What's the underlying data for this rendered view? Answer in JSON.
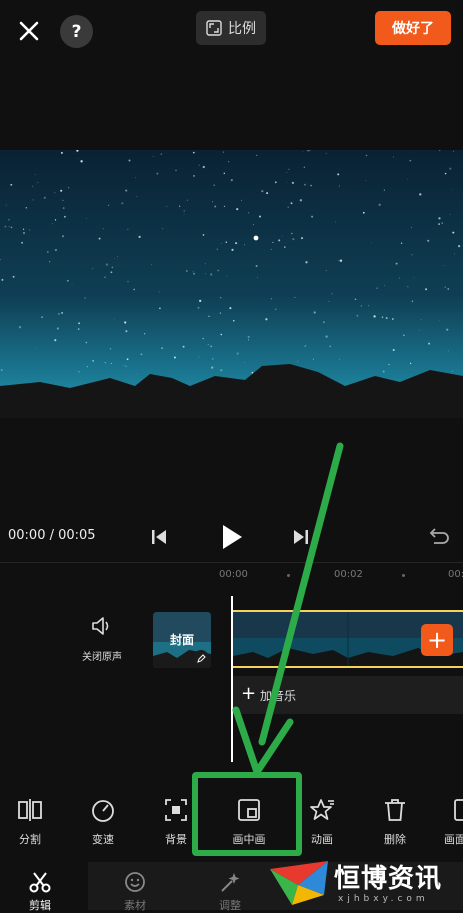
{
  "topbar": {
    "ratio_label": "比例",
    "done_label": "做好了",
    "help_label": "?"
  },
  "player": {
    "timecode": "00:00 / 00:05"
  },
  "ruler": {
    "ticks": [
      "00:00",
      "00:02",
      "00:0"
    ]
  },
  "timeline": {
    "mute_label": "关闭原声",
    "cover_label": "封面",
    "add_music_label": "加音乐",
    "add_music_plus": "+"
  },
  "tools": [
    {
      "label": "分割",
      "icon": "split-icon"
    },
    {
      "label": "变速",
      "icon": "speed-icon"
    },
    {
      "label": "背景",
      "icon": "background-icon"
    },
    {
      "label": "画中画",
      "icon": "picture-in-picture-icon"
    },
    {
      "label": "动画",
      "icon": "animation-icon"
    },
    {
      "label": "删除",
      "icon": "trash-icon"
    },
    {
      "label": "画面",
      "icon": "frame-icon"
    }
  ],
  "nav": [
    {
      "label": "剪辑",
      "icon": "scissors-icon"
    },
    {
      "label": "素材",
      "icon": "sticker-icon"
    },
    {
      "label": "调整",
      "icon": "adjust-icon"
    }
  ],
  "watermark": {
    "text": "恒博资讯",
    "url": "xjhbxy.com"
  },
  "colors": {
    "accent": "#f25a1b",
    "highlight": "#2dab49",
    "clip_border": "#f3d35c"
  }
}
